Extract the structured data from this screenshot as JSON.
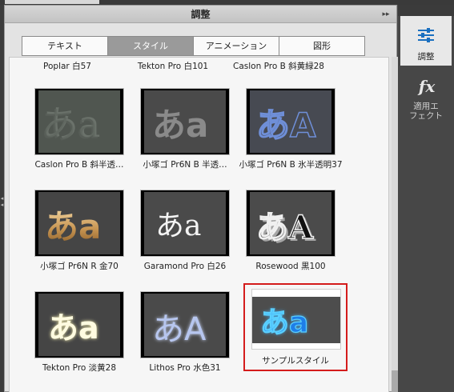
{
  "panel": {
    "title": "調整",
    "menu_glyph": "▸▸"
  },
  "tabs": [
    {
      "label": "テキスト",
      "active": false
    },
    {
      "label": "スタイル",
      "active": true
    },
    {
      "label": "アニメーション",
      "active": false
    },
    {
      "label": "図形",
      "active": false
    }
  ],
  "top_labels": [
    "Poplar 白57",
    "Tekton Pro 白101",
    "Caslon Pro B 斜黄緑28"
  ],
  "styles": [
    {
      "label": "Caslon Pro B 斜半透…",
      "sample": "あa"
    },
    {
      "label": "小塚ゴ Pr6N B 半透…",
      "sample": "あa"
    },
    {
      "label": "小塚ゴ Pr6N B 氷半透明37",
      "sample": "あA"
    },
    {
      "label": "小塚ゴ Pr6N R 金70",
      "sample": "あa"
    },
    {
      "label": "Garamond Pro 白26",
      "sample": "あa"
    },
    {
      "label": "Rosewood 黒100",
      "sample": "あA"
    },
    {
      "label": "Tekton Pro 淡黄28",
      "sample": "あa"
    },
    {
      "label": "Lithos Pro 水色31",
      "sample": "あA"
    },
    {
      "label": "サンプルスタイル",
      "sample": "あa",
      "selected": true
    }
  ],
  "right_toolbar": {
    "adjust_label": "調整",
    "effects_label_line1": "適用エ",
    "effects_label_line2": "フェクト",
    "fx_glyph": "fx"
  },
  "colors": {
    "selection_border": "#d41c1c",
    "sample_blue": "#1ea0f0",
    "active_tab": "#9a9a9a"
  }
}
